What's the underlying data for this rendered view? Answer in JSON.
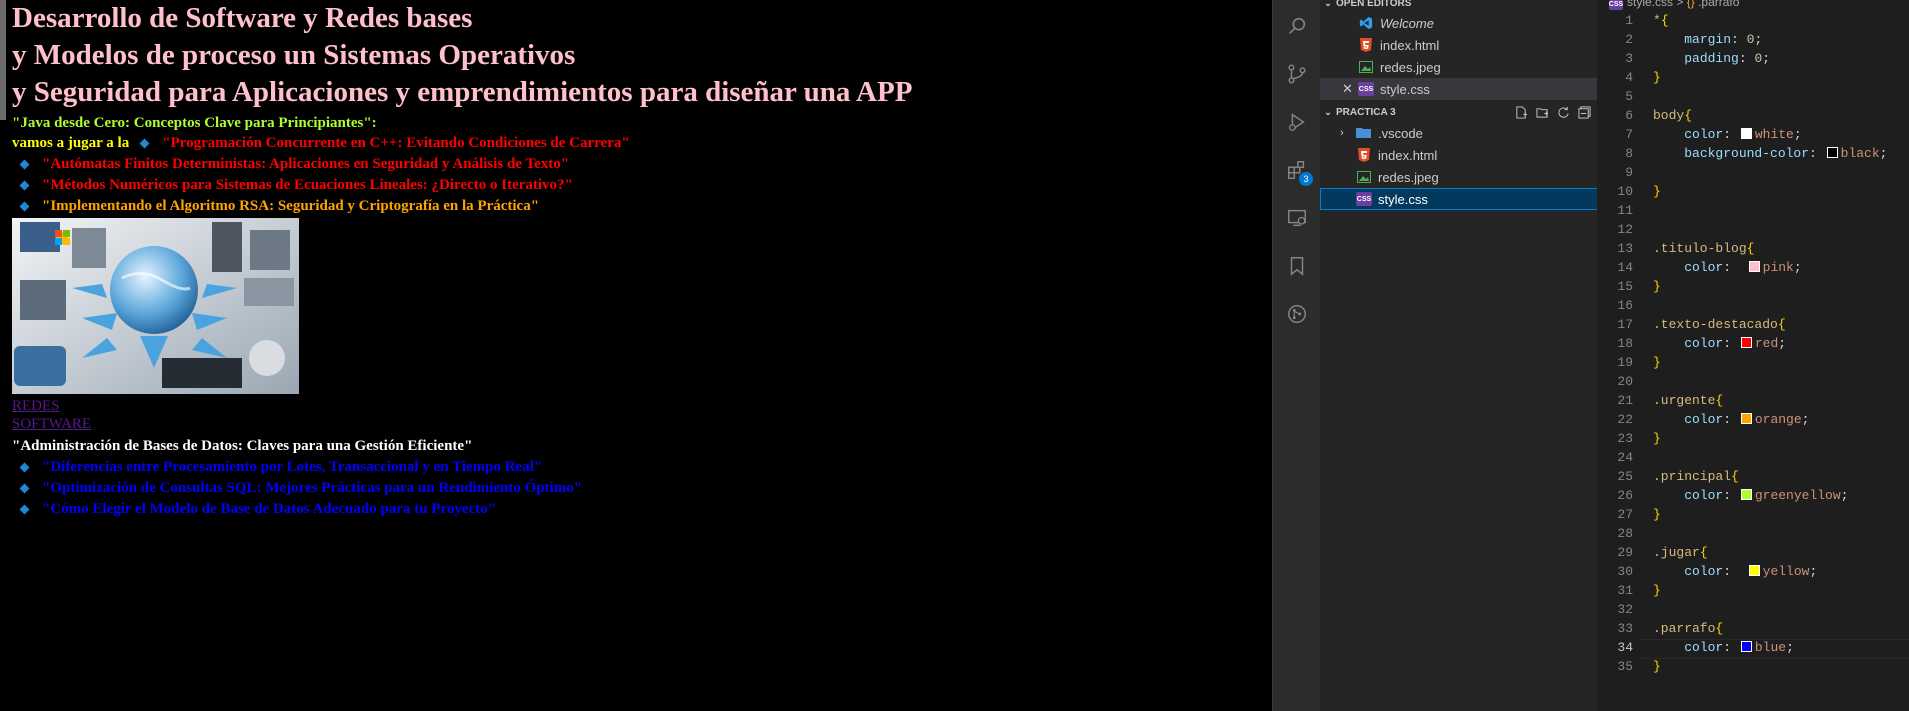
{
  "preview": {
    "title_lines": [
      "Desarrollo de Software y Redes bases",
      "y Modelos de proceso un Sistemas Operativos",
      "y Seguridad para Aplicaciones y emprendimientos para diseñar una APP"
    ],
    "principal_paragraph": "\"Java desde Cero: Conceptos Clave para Principiantes\":",
    "jugar_text": "vamos a jugar a la",
    "list_items": [
      "\"Programación Concurrente en C++: Evitando Condiciones de Carrera\"",
      "\"Autómatas Finitos Deterministas: Aplicaciones en Seguridad y Análisis de Texto\"",
      "\"Métodos Numéricos para Sistemas de Ecuaciones Lineales: ¿Directo o Iterativo?\"",
      "\"Implementando el Algoritmo RSA: Seguridad y Criptografía en la Práctica\""
    ],
    "links": [
      "REDES",
      "SOFTWARE"
    ],
    "db_heading": "\"Administración de Bases de Datos: Claves para una Gestión Eficiente\"",
    "db_items": [
      "\"Diferencias entre Procesamiento por Lotes, Transaccional y en Tiempo Real\"",
      "\"Optimización de Consultas SQL: Mejores Prácticas para un Rendimiento Óptimo\"",
      "\"Cómo Elegir el Modelo de Base de Datos Adecuado para tu Proyecto\""
    ]
  },
  "activity_bar": {
    "icons": [
      "search-icon",
      "source-control-icon",
      "run-debug-icon",
      "extensions-icon",
      "remote-explorer-icon",
      "bookmarks-icon",
      "git-graph-icon"
    ],
    "extensions_badge": "3"
  },
  "explorer": {
    "open_editors_label": "OPEN EDITORS",
    "open_editors": [
      "Welcome",
      "index.html",
      "redes.jpeg",
      "style.css"
    ],
    "folder_label": "PRACTICA 3",
    "files": [
      ".vscode",
      "index.html",
      "redes.jpeg",
      "style.css"
    ]
  },
  "editor": {
    "breadcrumb_file": "style.css",
    "breadcrumb_sep": ">",
    "breadcrumb_symbol": ".parrafo",
    "active_line": 34,
    "colors": {
      "white": "#ffffff",
      "black": "#000000",
      "pink": "#ffc0cb",
      "red": "#ff0000",
      "orange": "#ffa500",
      "greenyellow": "#adff2f",
      "yellow": "#ffff00",
      "blue": "#0000ff"
    },
    "lines": [
      {
        "n": "1",
        "sel": "*",
        "brace": "{"
      },
      {
        "n": "2",
        "prop": "margin",
        "val": "0",
        "num": true
      },
      {
        "n": "3",
        "prop": "padding",
        "val": "0",
        "num": true
      },
      {
        "n": "4",
        "brace": "}"
      },
      {
        "n": "5"
      },
      {
        "n": "6",
        "sel": "body",
        "brace": "{"
      },
      {
        "n": "7",
        "prop": "color",
        "val": "white",
        "swatch": "white"
      },
      {
        "n": "8",
        "prop": "background-color",
        "val": "black",
        "swatch": "black"
      },
      {
        "n": "9"
      },
      {
        "n": "10",
        "brace": "}"
      },
      {
        "n": "11"
      },
      {
        "n": "12"
      },
      {
        "n": "13",
        "sel": ".titulo-blog",
        "brace": "{"
      },
      {
        "n": "14",
        "prop": "color",
        "val": "pink",
        "swatch": "pink",
        "pad": true
      },
      {
        "n": "15",
        "brace": "}"
      },
      {
        "n": "16"
      },
      {
        "n": "17",
        "sel": ".texto-destacado",
        "brace": "{"
      },
      {
        "n": "18",
        "prop": "color",
        "val": "red",
        "swatch": "red"
      },
      {
        "n": "19",
        "brace": "}"
      },
      {
        "n": "20"
      },
      {
        "n": "21",
        "sel": ".urgente",
        "brace": "{"
      },
      {
        "n": "22",
        "prop": "color",
        "val": "orange",
        "swatch": "orange"
      },
      {
        "n": "23",
        "brace": "}"
      },
      {
        "n": "24"
      },
      {
        "n": "25",
        "sel": ".principal",
        "brace": "{"
      },
      {
        "n": "26",
        "prop": "color",
        "val": "greenyellow",
        "swatch": "greenyellow"
      },
      {
        "n": "27",
        "brace": "}"
      },
      {
        "n": "28"
      },
      {
        "n": "29",
        "sel": ".jugar",
        "brace": "{"
      },
      {
        "n": "30",
        "prop": "color",
        "val": "yellow",
        "swatch": "yellow",
        "pad": true
      },
      {
        "n": "31",
        "brace": "}"
      },
      {
        "n": "32"
      },
      {
        "n": "33",
        "sel": ".parrafo",
        "brace": "{"
      },
      {
        "n": "34",
        "prop": "color",
        "val": "blue",
        "swatch": "blue"
      },
      {
        "n": "35",
        "brace": "}"
      }
    ]
  }
}
